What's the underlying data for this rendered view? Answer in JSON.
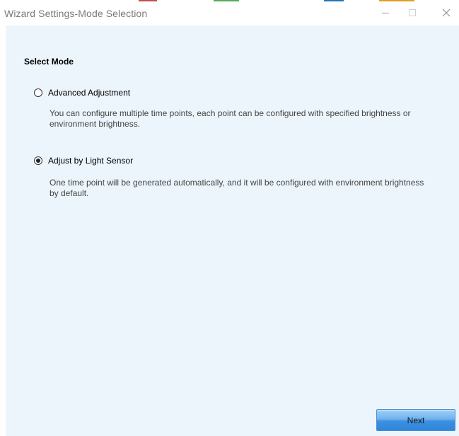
{
  "window": {
    "title": "Wizard Settings-Mode Selection",
    "minimize_icon": "minimize-icon",
    "maximize_icon": "maximize-icon",
    "close_icon": "close-icon",
    "accent_colors": [
      "#c0504d",
      "#4caf50",
      "#1f77b4",
      "#e0a020"
    ]
  },
  "content": {
    "section_title": "Select Mode",
    "options": [
      {
        "label": "Advanced Adjustment",
        "description": "You can configure multiple time points, each point can be configured with specified brightness or environment brightness.",
        "selected": false
      },
      {
        "label": "Adjust by Light Sensor",
        "description": "One time point will be generated automatically, and it will be configured with environment brightness by default.",
        "selected": true
      }
    ]
  },
  "footer": {
    "next_label": "Next"
  },
  "colors": {
    "content_background": "#ecf5fc",
    "button_blue": "#3c90e0",
    "title_text": "#7a7a7a"
  }
}
